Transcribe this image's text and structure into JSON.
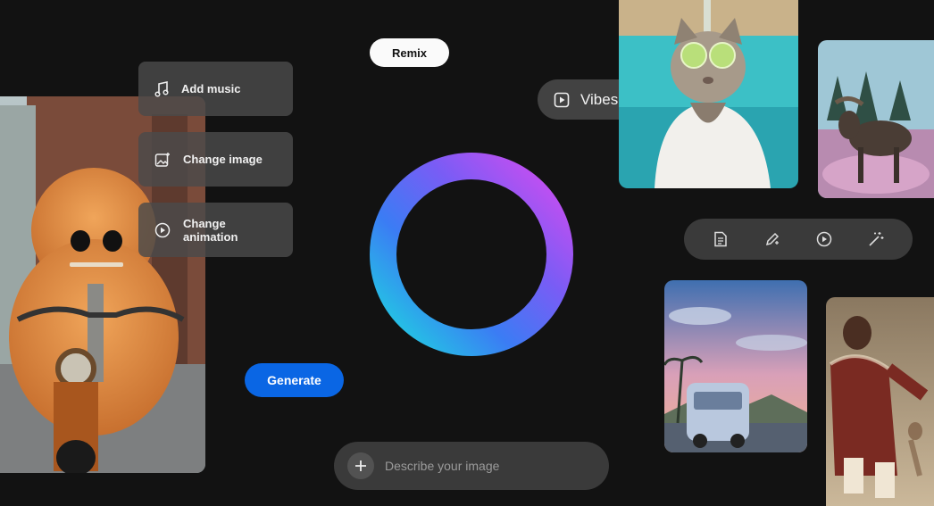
{
  "top_pill": {
    "label": "Remix"
  },
  "menu": {
    "items": [
      {
        "label": "Add music",
        "icon": "music-note-icon"
      },
      {
        "label": "Change image",
        "icon": "image-edit-icon"
      },
      {
        "label": "Change animation",
        "icon": "play-circle-icon"
      }
    ]
  },
  "vibes": {
    "label": "Vibes",
    "icon": "play-square-icon"
  },
  "generate": {
    "label": "Generate"
  },
  "prompt": {
    "placeholder": "Describe your image",
    "add_icon": "plus-icon"
  },
  "toolbar": {
    "icons": [
      "document-icon",
      "pencil-sparkle-icon",
      "play-circle-icon",
      "magic-wand-icon"
    ]
  },
  "colors": {
    "accent": "#0a66e4",
    "ring_start": "#c44bf0",
    "ring_end": "#1ed0e8",
    "background": "#121212"
  }
}
